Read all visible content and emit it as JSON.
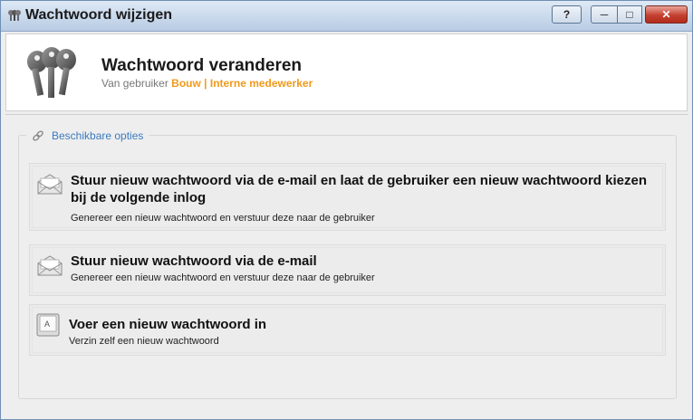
{
  "window": {
    "title": "Wachtwoord wijzigen",
    "help_label": "?",
    "min_label": "─",
    "max_label": "□",
    "close_label": "✕"
  },
  "header": {
    "title": "Wachtwoord veranderen",
    "subtitle_prefix": "Van gebruiker",
    "user": "Bouw | Interne medewerker",
    "icon": "keys-icon"
  },
  "options_group": {
    "legend": "Beschikbare opties",
    "legend_icon": "link-icon",
    "options": [
      {
        "title": "Stuur nieuw wachtwoord via de e-mail en laat de gebruiker een nieuw wachtwoord kiezen bij de volgende inlog",
        "description": "Genereer een nieuw wachtwoord en verstuur deze naar de gebruiker",
        "icon": "envelope-icon"
      },
      {
        "title": "Stuur nieuw wachtwoord via de e-mail",
        "description": "Genereer een nieuw wachtwoord en verstuur deze naar de gebruiker",
        "icon": "envelope-icon"
      },
      {
        "title": "Voer een nieuw wachtwoord in",
        "description": "Verzin zelf een nieuw wachtwoord",
        "icon": "keyboard-key-icon",
        "icon_letter": "A"
      }
    ]
  },
  "colors": {
    "accent_user": "#f09a1b",
    "legend_text": "#3a7bc0",
    "close_button": "#c4402f"
  }
}
